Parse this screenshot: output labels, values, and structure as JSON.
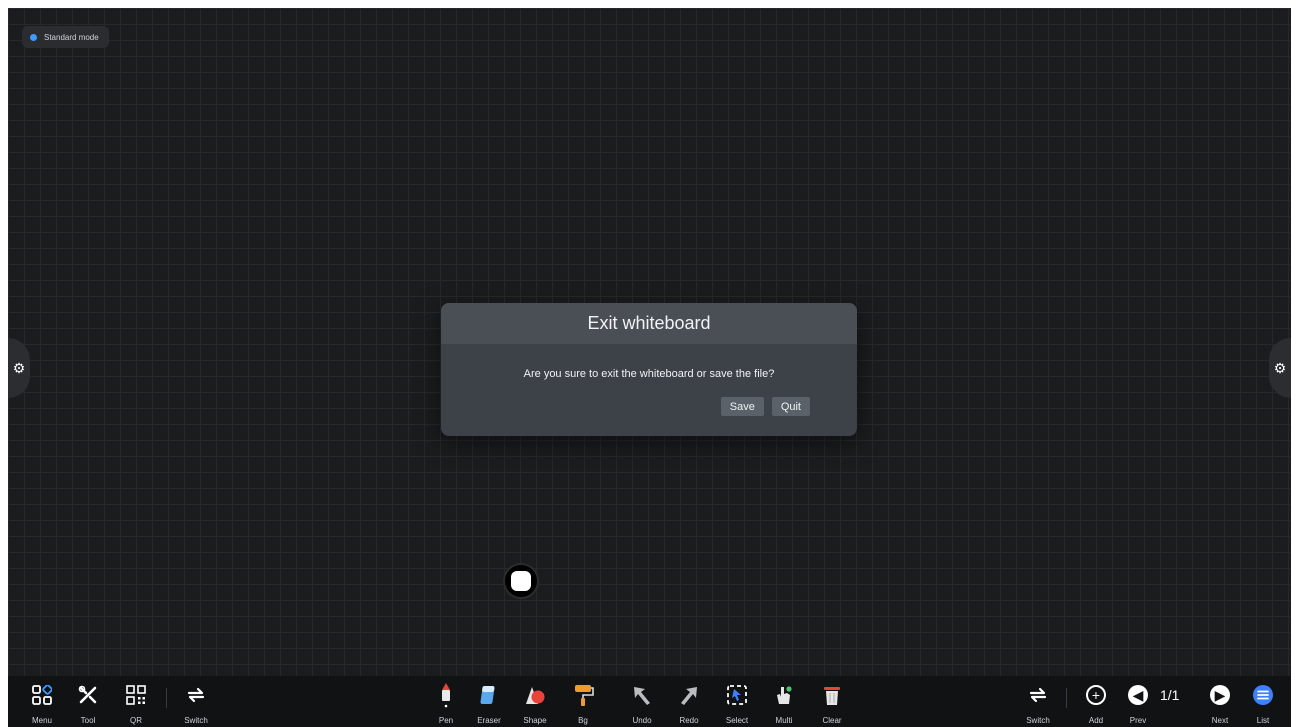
{
  "mode_badge": {
    "label": "Standard mode",
    "dot_color": "#3d9bff"
  },
  "dialog": {
    "title": "Exit whiteboard",
    "message": "Are you sure to exit the whiteboard or save the file?",
    "save_label": "Save",
    "quit_label": "Quit"
  },
  "toolbar": {
    "left": [
      {
        "label": "Menu",
        "icon": "menu-grid-icon"
      },
      {
        "label": "Tool",
        "icon": "tools-icon"
      },
      {
        "label": "QR",
        "icon": "qr-code-icon"
      },
      {
        "label": "Switch",
        "icon": "switch-icon"
      }
    ],
    "center": [
      {
        "label": "Pen",
        "icon": "pen-icon"
      },
      {
        "label": "Eraser",
        "icon": "eraser-icon"
      },
      {
        "label": "Shape",
        "icon": "shape-icon"
      },
      {
        "label": "Bg",
        "icon": "paint-roller-icon"
      },
      {
        "label": "Undo",
        "icon": "undo-icon"
      },
      {
        "label": "Redo",
        "icon": "redo-icon"
      },
      {
        "label": "Select",
        "icon": "select-icon"
      },
      {
        "label": "Multi",
        "icon": "multi-touch-icon"
      },
      {
        "label": "Clear",
        "icon": "trash-icon"
      }
    ],
    "right": [
      {
        "label": "Switch",
        "icon": "switch-icon"
      },
      {
        "label": "Add",
        "icon": "add-page-icon"
      },
      {
        "label": "Prev",
        "icon": "prev-page-icon"
      },
      {
        "label": "Next",
        "icon": "next-page-icon"
      },
      {
        "label": "List",
        "icon": "page-list-icon"
      }
    ],
    "page_indicator": "1/1"
  }
}
